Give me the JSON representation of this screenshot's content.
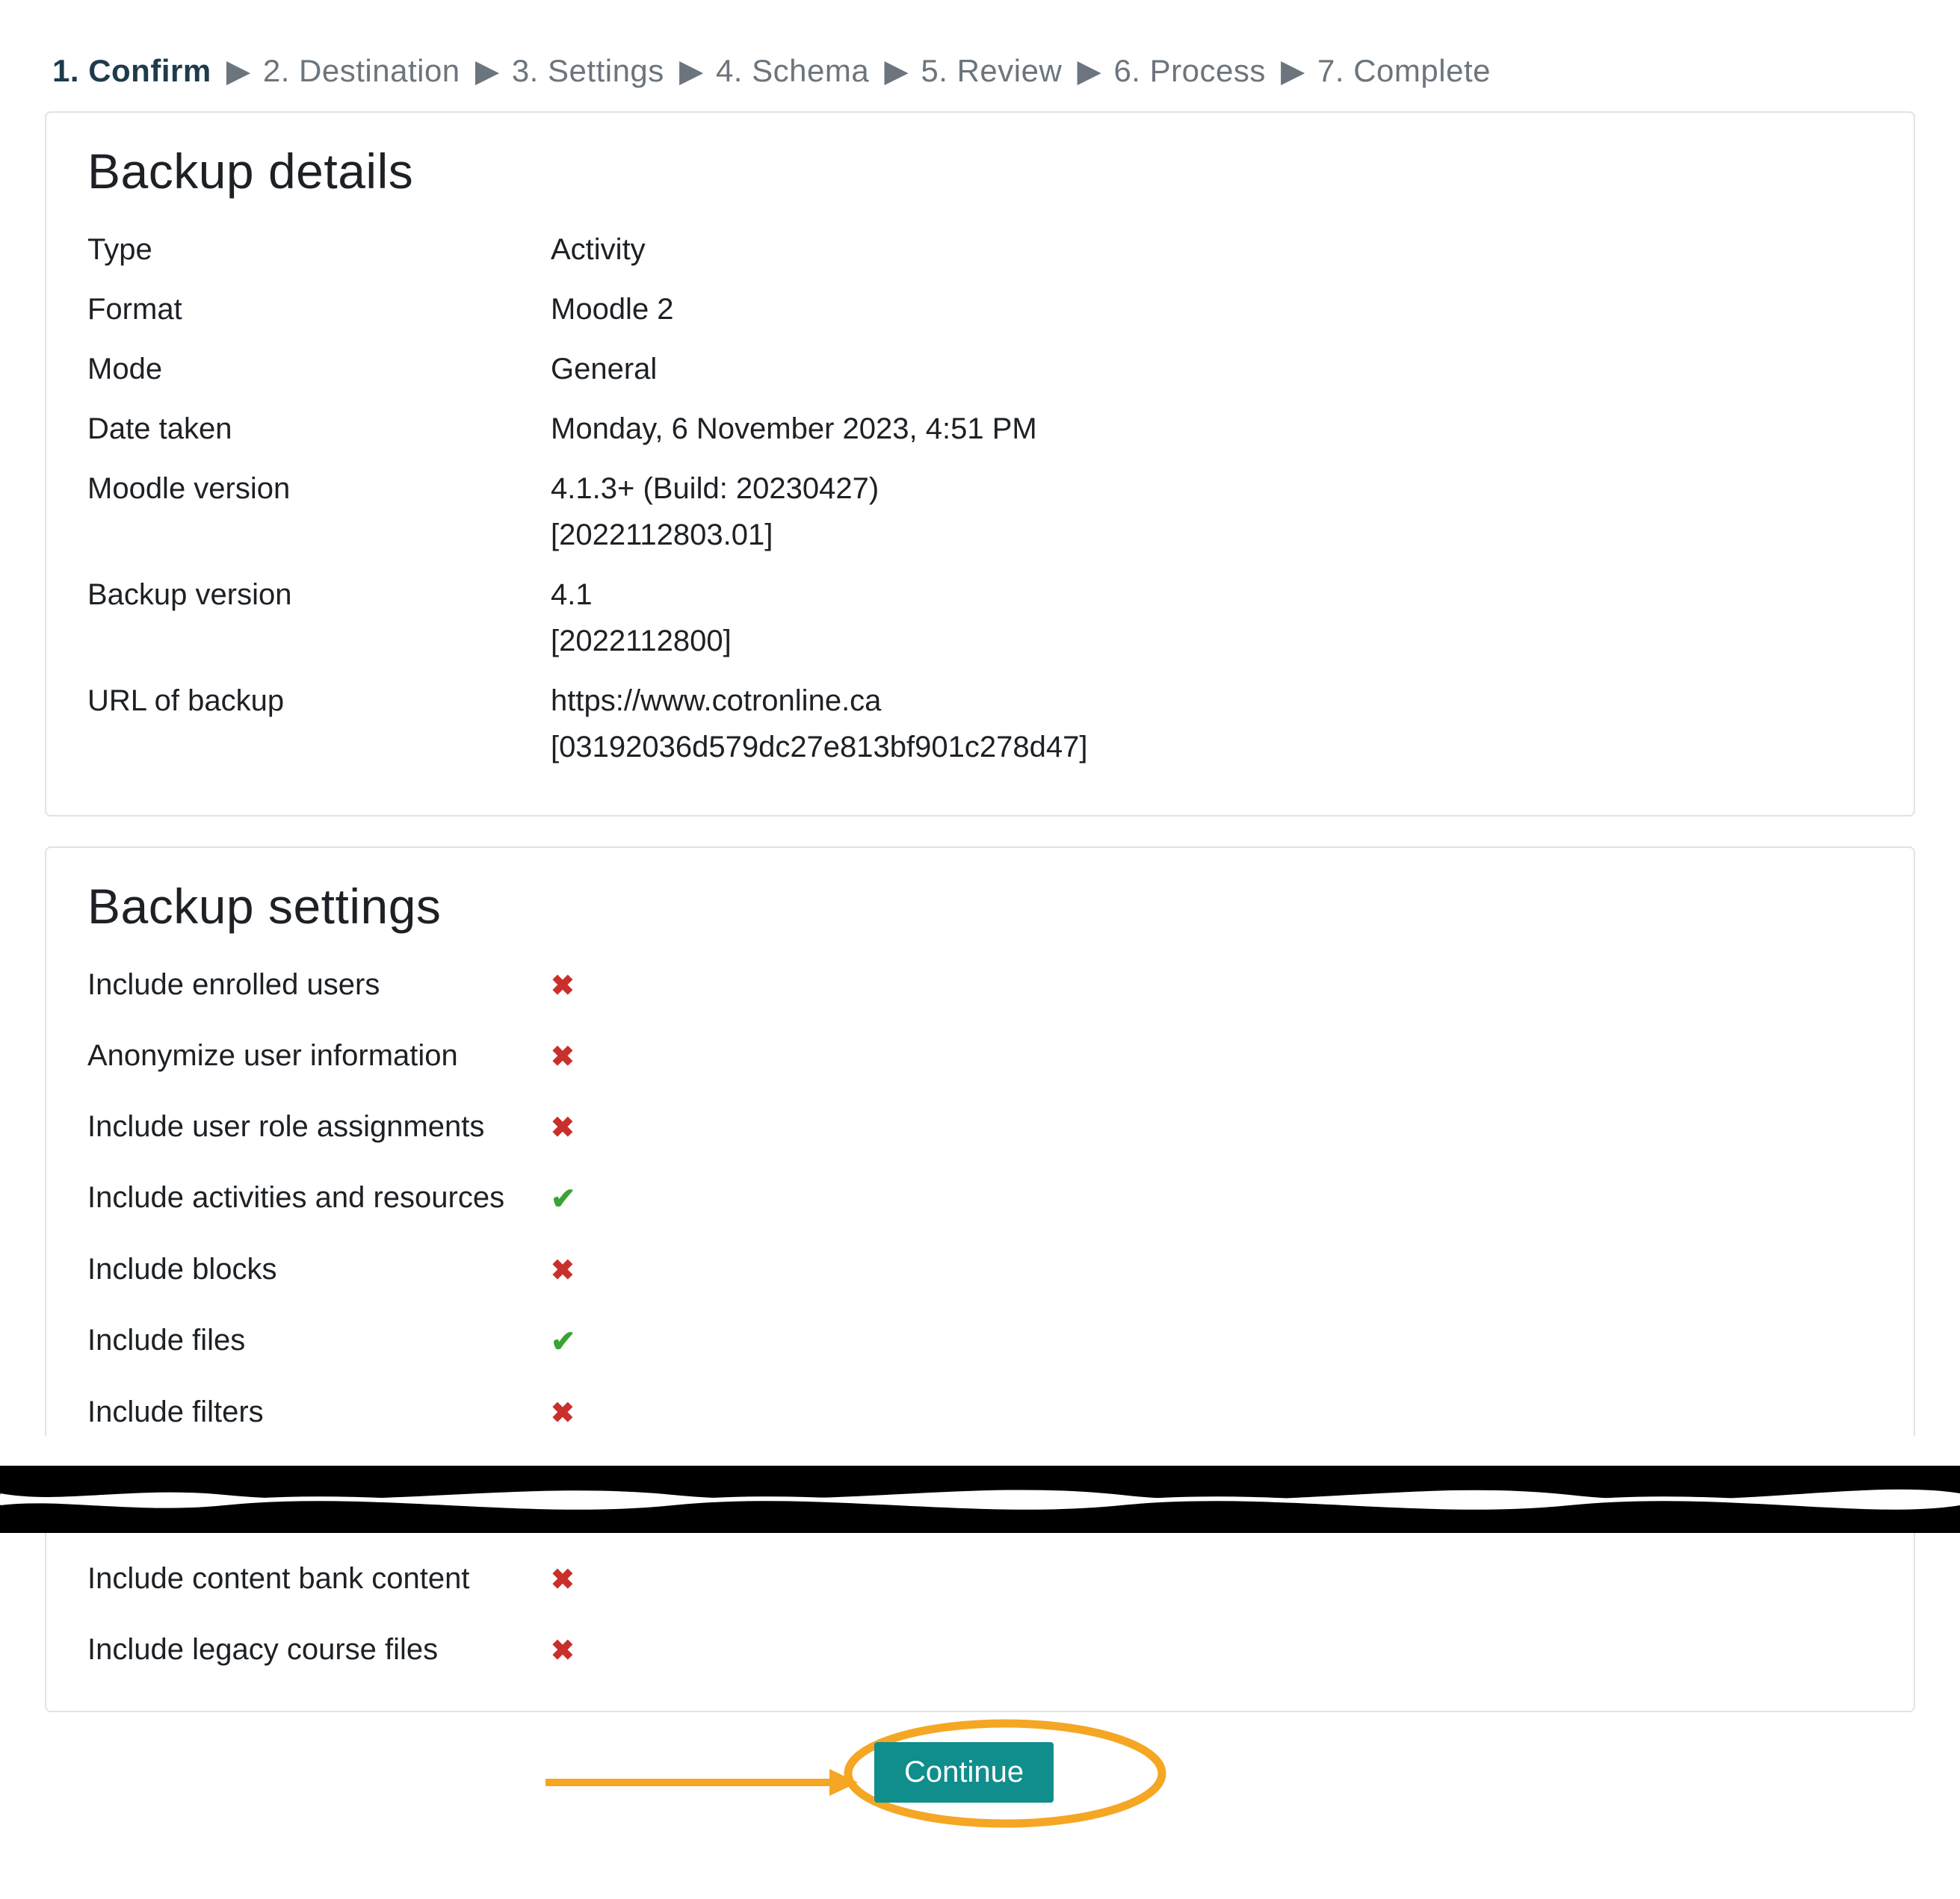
{
  "colors": {
    "accent": "#0f8e8c",
    "highlight": "#f5a623",
    "x": "#c9302c",
    "check": "#3aa335"
  },
  "wizard": {
    "steps": [
      "1. Confirm",
      "2. Destination",
      "3. Settings",
      "4. Schema",
      "5. Review",
      "6. Process",
      "7. Complete"
    ],
    "active_index": 0
  },
  "details": {
    "heading": "Backup details",
    "rows": [
      {
        "label": "Type",
        "value": "Activity"
      },
      {
        "label": "Format",
        "value": "Moodle 2"
      },
      {
        "label": "Mode",
        "value": "General"
      },
      {
        "label": "Date taken",
        "value": "Monday, 6 November 2023, 4:51 PM"
      },
      {
        "label": "Moodle version",
        "value": "4.1.3+ (Build: 20230427)",
        "value2": "[2022112803.01]"
      },
      {
        "label": "Backup version",
        "value": "4.1",
        "value2": "[2022112800]"
      },
      {
        "label": "URL of backup",
        "value": "https://www.cotronline.ca",
        "value2": "[03192036d579dc27e813bf901c278d47]"
      }
    ]
  },
  "settings": {
    "heading": "Backup settings",
    "top_rows": [
      {
        "label": "Include enrolled users",
        "state": "x"
      },
      {
        "label": "Anonymize user information",
        "state": "x"
      },
      {
        "label": "Include user role assignments",
        "state": "x"
      },
      {
        "label": "Include activities and resources",
        "state": "check"
      },
      {
        "label": "Include blocks",
        "state": "x"
      },
      {
        "label": "Include files",
        "state": "check"
      },
      {
        "label": "Include filters",
        "state": "x"
      }
    ],
    "bottom_rows": [
      {
        "label": "Include content bank content",
        "state": "x"
      },
      {
        "label": "Include legacy course files",
        "state": "x"
      }
    ]
  },
  "action": {
    "continue_label": "Continue"
  }
}
